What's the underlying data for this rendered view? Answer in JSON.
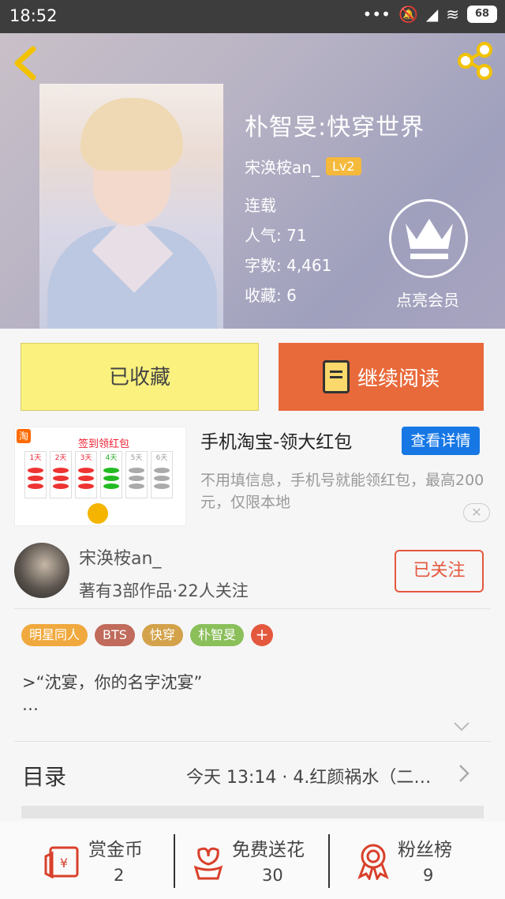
{
  "status": {
    "time": "18:52",
    "battery": "68"
  },
  "book": {
    "title": "朴智旻:快穿世界",
    "author": "宋涣桉an_",
    "level": "Lv2",
    "state": "连载",
    "popularity": "人气: 71",
    "word_count": "字数: 4,461",
    "favorites": "收藏: 6"
  },
  "vip_label": "点亮会员",
  "actions": {
    "favorited": "已收藏",
    "continue_reading": "继续阅读"
  },
  "ad": {
    "image_title": "签到领红包",
    "image_logo": "淘",
    "day_labels": [
      "1天",
      "2天",
      "3天",
      "4天",
      "5天",
      "6天"
    ],
    "title": "手机淘宝-领大红包",
    "button": "查看详情",
    "description": "不用填信息，手机号就能领红包，最高200元，仅限本地",
    "close": "✕"
  },
  "author_card": {
    "name": "宋涣桉an_",
    "info": "著有3部作品·22人关注",
    "follow": "已关注"
  },
  "tags": [
    {
      "label": "明星同人",
      "color": "#f0a93e"
    },
    {
      "label": "BTS",
      "color": "#c06b5b"
    },
    {
      "label": "快穿",
      "color": "#d3a24a"
    },
    {
      "label": "朴智旻",
      "color": "#8bbf5a"
    }
  ],
  "tag_add": "+",
  "synopsis": {
    "line1": ">“沈宴，你的名字沈宴”",
    "line2": "…"
  },
  "toc": {
    "label": "目录",
    "latest": "今天 13:14 · 4.红颜祸水（二…"
  },
  "bottom_bar": [
    {
      "label": "赏金币",
      "value": "2",
      "icon": "coin-envelope-icon"
    },
    {
      "label": "免费送花",
      "value": "30",
      "icon": "flower-icon"
    },
    {
      "label": "粉丝榜",
      "value": "9",
      "icon": "medal-icon"
    }
  ],
  "colors": {
    "accent": "#e8693a",
    "favorite_bg": "#faf17e",
    "ad_button": "#1677e5",
    "follow": "#e4583e"
  }
}
